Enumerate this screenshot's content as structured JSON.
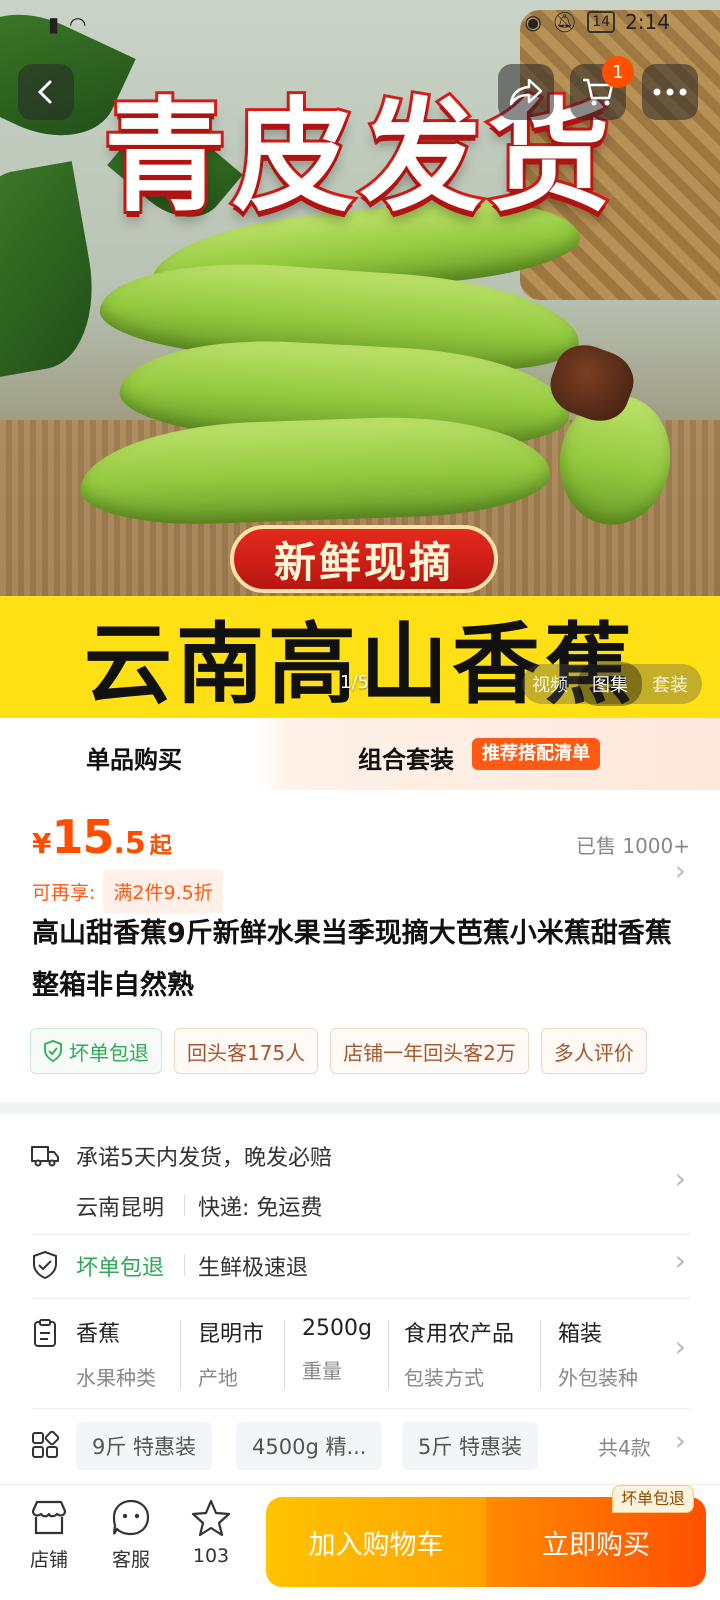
{
  "status_bar": {
    "time": "2:14",
    "battery": "14"
  },
  "hero": {
    "headline": "青皮发货",
    "badge": "新鲜现摘",
    "band_text": "云南高山香蕉",
    "page_indicator": "1/5",
    "media_tabs": [
      "视频",
      "图集",
      "套装"
    ],
    "cart_count": "1"
  },
  "buy_tabs": {
    "single": "单品购买",
    "combo": "组合套装",
    "combo_tag": "推荐搭配清单"
  },
  "product": {
    "price_symbol": "¥",
    "price_int": "15",
    "price_dec": ".5",
    "price_suffix": "起",
    "sold": "已售 1000+",
    "promo_label": "可再享:",
    "promo_tag": "满2件9.5折",
    "title": "高山甜香蕉9斤新鲜水果当季现摘大芭蕉小米蕉甜香蕉整箱非自然熟",
    "chips": [
      "坏单包退",
      "回头客175人",
      "店铺一年回头客2万",
      "多人评价"
    ]
  },
  "service": {
    "shipping_promise": "承诺5天内发货，晚发必赔",
    "origin": "云南昆明",
    "delivery": "快递: 免运费",
    "guarantee": "坏单包退",
    "guarantee_detail": "生鲜极速退",
    "specs": [
      {
        "value": "香蕉",
        "key": "水果种类"
      },
      {
        "value": "昆明市",
        "key": "产地"
      },
      {
        "value": "2500g",
        "key": "重量"
      },
      {
        "value": "食用农产品",
        "key": "包装方式"
      },
      {
        "value": "箱装",
        "key": "外包装种"
      }
    ],
    "variants": [
      "9斤 特惠装",
      "4500g 精...",
      "5斤 特惠装"
    ],
    "variant_total": "共4款"
  },
  "bottom_bar": {
    "shop": "店铺",
    "service": "客服",
    "favorites": "103",
    "add_to_cart": "加入购物车",
    "buy_now": "立即购买",
    "buy_tag": "坏单包退"
  },
  "colors": {
    "accent": "#ff5000",
    "price": "#ff4d00",
    "green": "#2eaa57",
    "band": "#ffe014"
  }
}
